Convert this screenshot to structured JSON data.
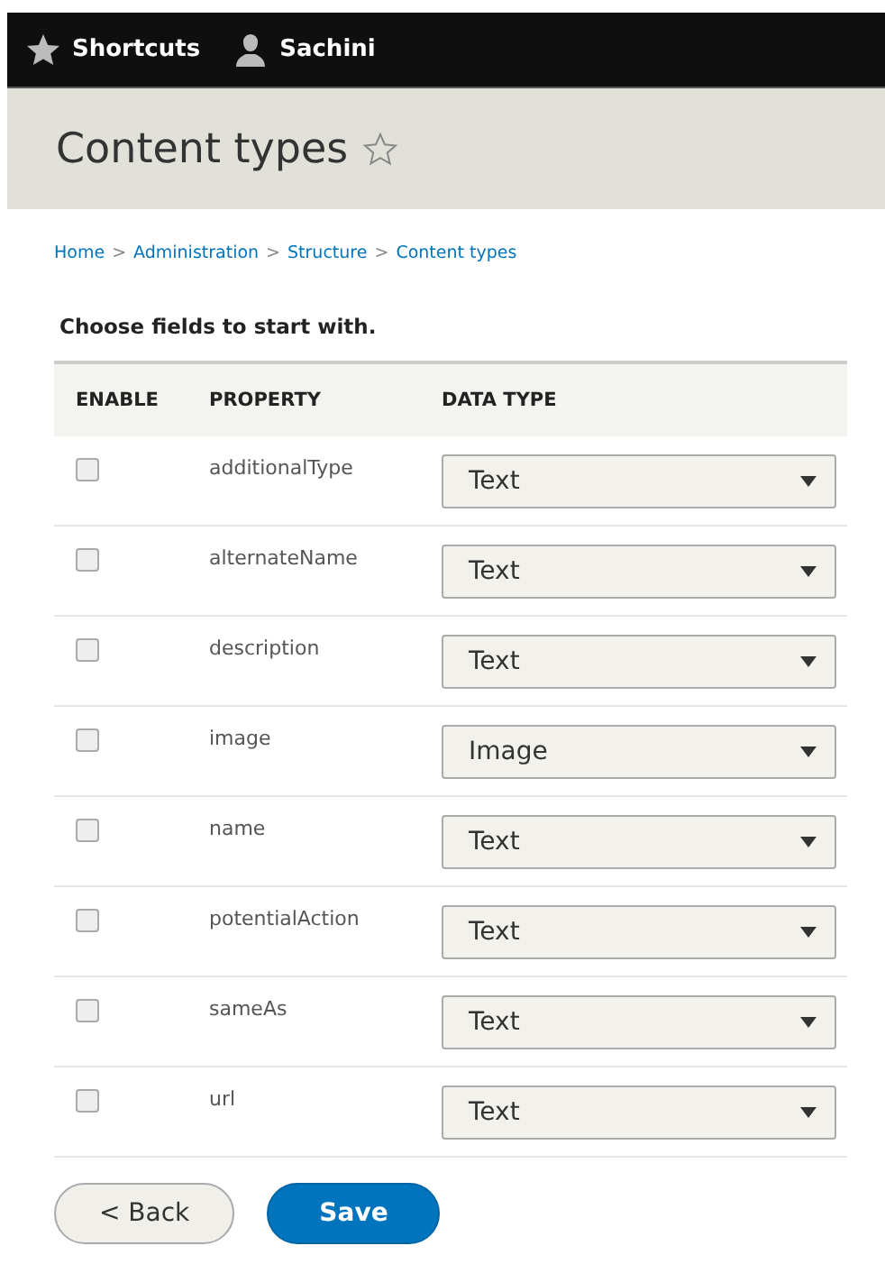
{
  "toolbar": {
    "items": [
      {
        "label": "Shortcuts",
        "kind": "star"
      },
      {
        "label": "Sachini",
        "kind": "user"
      }
    ]
  },
  "page_title": "Content types",
  "breadcrumb": [
    "Home",
    "Administration",
    "Structure",
    "Content types"
  ],
  "breadcrumb_separator": ">",
  "section_title": "Choose fields to start with.",
  "table": {
    "columns": [
      "ENABLE",
      "PROPERTY",
      "DATA TYPE"
    ],
    "rows": [
      {
        "checked": false,
        "property": "additionalType",
        "data_type": "Text"
      },
      {
        "checked": false,
        "property": "alternateName",
        "data_type": "Text"
      },
      {
        "checked": false,
        "property": "description",
        "data_type": "Text"
      },
      {
        "checked": false,
        "property": "image",
        "data_type": "Image"
      },
      {
        "checked": false,
        "property": "name",
        "data_type": "Text"
      },
      {
        "checked": false,
        "property": "potentialAction",
        "data_type": "Text"
      },
      {
        "checked": false,
        "property": "sameAs",
        "data_type": "Text"
      },
      {
        "checked": false,
        "property": "url",
        "data_type": "Text"
      }
    ]
  },
  "buttons": [
    {
      "label": "< Back",
      "kind": "secondary"
    },
    {
      "label": "Save",
      "kind": "primary"
    }
  ]
}
